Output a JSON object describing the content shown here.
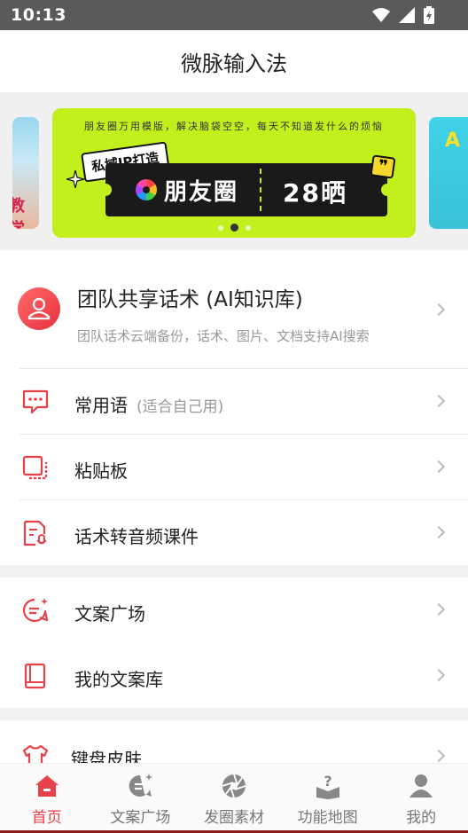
{
  "status_bar": {
    "time": "10:13",
    "icons": [
      "wifi-icon",
      "signal-icon",
      "battery-icon"
    ]
  },
  "app_bar": {
    "title": "微脉输入法"
  },
  "banner": {
    "left_card_text": "教学",
    "right_card_text": "A",
    "caption": "朋友圈万用模版，解决脑袋空空，每天不知道发什么的烦恼",
    "tag": "私域IP打造",
    "ticket_title": "朋友圈",
    "ticket_days": "28晒",
    "quote_mark": "❞",
    "page_count": 3,
    "active_page": 1
  },
  "features": {
    "team": {
      "title": "团队共享话术 (AI知识库)",
      "subtitle": "团队话术云端备份，话术、图片、文档支持AI搜索"
    },
    "items": [
      {
        "label": "常用语",
        "hint": "(适合自己用)",
        "icon": "chat-bubble-icon"
      },
      {
        "label": "粘贴板",
        "icon": "clipboard-icon"
      },
      {
        "label": "话术转音频课件",
        "icon": "audio-file-icon"
      }
    ],
    "items2": [
      {
        "label": "文案广场",
        "icon": "message-square-icon"
      },
      {
        "label": "我的文案库",
        "icon": "book-icon"
      }
    ],
    "items3": [
      {
        "label": "键盘皮肤",
        "icon": "shirt-icon"
      }
    ]
  },
  "tabbar": {
    "tabs": [
      {
        "label": "首页",
        "icon": "home-icon",
        "active": true
      },
      {
        "label": "文案广场",
        "icon": "message-square-icon"
      },
      {
        "label": "发圈素材",
        "icon": "aperture-icon"
      },
      {
        "label": "功能地图",
        "icon": "map-book-icon"
      },
      {
        "label": "我的",
        "icon": "user-icon"
      }
    ]
  },
  "colors": {
    "accent": "#e9414a",
    "banner_bg": "#c2f01c",
    "status_bar": "#5a5a5a"
  }
}
